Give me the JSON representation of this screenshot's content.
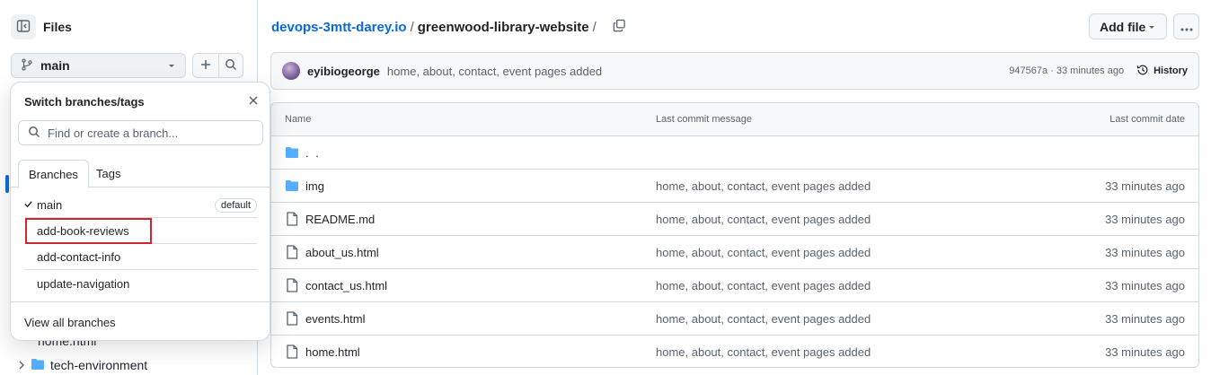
{
  "sidebar": {
    "title": "Files",
    "branch": "main",
    "tree": {
      "partial_file": "home.html",
      "folder": "tech-environment"
    }
  },
  "popover": {
    "title": "Switch branches/tags",
    "search_placeholder": "Find or create a branch...",
    "tabs": [
      "Branches",
      "Tags"
    ],
    "branches": [
      {
        "name": "main",
        "badge": "default",
        "checked": true
      },
      {
        "name": "add-book-reviews"
      },
      {
        "name": "add-contact-info"
      },
      {
        "name": "update-navigation"
      }
    ],
    "footer": "View all branches"
  },
  "breadcrumb": {
    "repo": "devops-3mtt-darey.io",
    "sep": "/",
    "folder": "greenwood-library-website",
    "trail": "/"
  },
  "toolbar": {
    "add_file": "Add file"
  },
  "commit": {
    "author": "eyibiogeorge",
    "message": "home, about, contact, event pages added",
    "meta": "947567a · 33 minutes ago",
    "history": "History"
  },
  "table": {
    "headers": {
      "name": "Name",
      "message": "Last commit message",
      "date": "Last commit date"
    },
    "rows": [
      {
        "type": "parent",
        "name": ". .",
        "message": "",
        "date": ""
      },
      {
        "type": "folder",
        "name": "img",
        "message": "home, about, contact, event pages added",
        "date": "33 minutes ago"
      },
      {
        "type": "file",
        "name": "README.md",
        "message": "home, about, contact, event pages added",
        "date": "33 minutes ago"
      },
      {
        "type": "file",
        "name": "about_us.html",
        "message": "home, about, contact, event pages added",
        "date": "33 minutes ago"
      },
      {
        "type": "file",
        "name": "contact_us.html",
        "message": "home, about, contact, event pages added",
        "date": "33 minutes ago"
      },
      {
        "type": "file",
        "name": "events.html",
        "message": "home, about, contact, event pages added",
        "date": "33 minutes ago"
      },
      {
        "type": "file",
        "name": "home.html",
        "message": "home, about, contact, event pages added",
        "date": "33 minutes ago"
      }
    ]
  },
  "colors": {
    "link": "#0969da",
    "folder": "#54aeff",
    "highlight": "#d1242f",
    "border": "#d1d9e0",
    "muted": "#59636e"
  }
}
